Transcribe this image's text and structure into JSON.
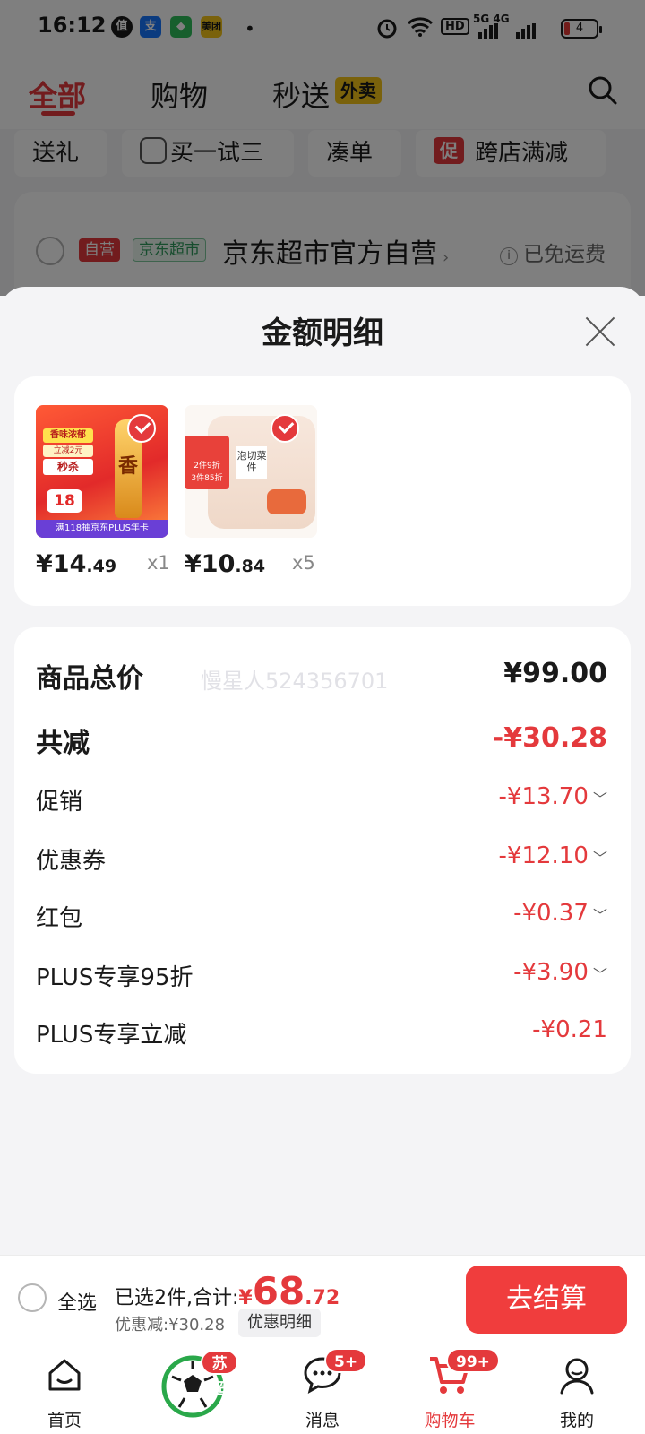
{
  "status_bar": {
    "time": "16:12",
    "apps": [
      "值",
      "支",
      "◆",
      "美团"
    ],
    "network": "5G 4G",
    "hd": "HD",
    "battery": "4"
  },
  "top_tabs": [
    {
      "label": "全部",
      "active": true
    },
    {
      "label": "购物",
      "active": false
    },
    {
      "label": "秒送",
      "active": false
    }
  ],
  "top_tab_badge": "外卖",
  "chips": [
    {
      "label": "送礼"
    },
    {
      "label": "买一试三"
    },
    {
      "label": "凑单"
    },
    {
      "label": "跨店满减",
      "badge": "促"
    }
  ],
  "shop": {
    "tag_self": "自营",
    "tag_market": "京东超市",
    "name": "京东超市官方自营",
    "shipping": "已免运费"
  },
  "sheet": {
    "title": "金额明细",
    "products": [
      {
        "price_int": "¥14",
        "price_dec": ".49",
        "qty": "x1",
        "banner_lines": [
          "香味浓郁",
          "立减2元",
          "秒杀",
          "18",
          "香",
          "满118抽京东PLUS年卡"
        ]
      },
      {
        "price_int": "¥10",
        "price_dec": ".84",
        "qty": "x5",
        "banner_lines": [
          "2件9折",
          "3件85折",
          "泡切菜件"
        ]
      }
    ],
    "rows": [
      {
        "label": "商品总价",
        "value": "¥99.00",
        "bold": true,
        "red": false,
        "chevron": false
      },
      {
        "label": "共减",
        "value": "-¥30.28",
        "bold": true,
        "red": true,
        "chevron": false
      },
      {
        "label": "促销",
        "value": "-¥13.70",
        "bold": false,
        "red": true,
        "chevron": true
      },
      {
        "label": "优惠券",
        "value": "-¥12.10",
        "bold": false,
        "red": true,
        "chevron": true
      },
      {
        "label": "红包",
        "value": "-¥0.37",
        "bold": false,
        "red": true,
        "chevron": true
      },
      {
        "label": "PLUS专享95折",
        "value": "-¥3.90",
        "bold": false,
        "red": true,
        "chevron": true
      },
      {
        "label": "PLUS专享立减",
        "value": "-¥0.21",
        "bold": false,
        "red": true,
        "chevron": false
      }
    ],
    "watermark": "慢星人524356701"
  },
  "checkout": {
    "select_all": "全选",
    "selected_prefix": "已选2件,合计:",
    "currency": "¥",
    "total_int": "68",
    "total_dec": ".72",
    "discount": "优惠减:¥30.28",
    "detail_btn": "优惠明细",
    "pay_btn": "去结算"
  },
  "bottom_nav": [
    {
      "label": "首页",
      "icon": "home-icon",
      "badge": ""
    },
    {
      "label": "",
      "icon": "soccer-ball-icon",
      "badge": "苏超"
    },
    {
      "label": "消息",
      "icon": "message-icon",
      "badge": "5+"
    },
    {
      "label": "购物车",
      "icon": "cart-icon",
      "badge": "99+",
      "active": true
    },
    {
      "label": "我的",
      "icon": "profile-icon",
      "badge": ""
    }
  ],
  "colors": {
    "accent": "#e4393c",
    "pay_button": "#f03d3d"
  }
}
